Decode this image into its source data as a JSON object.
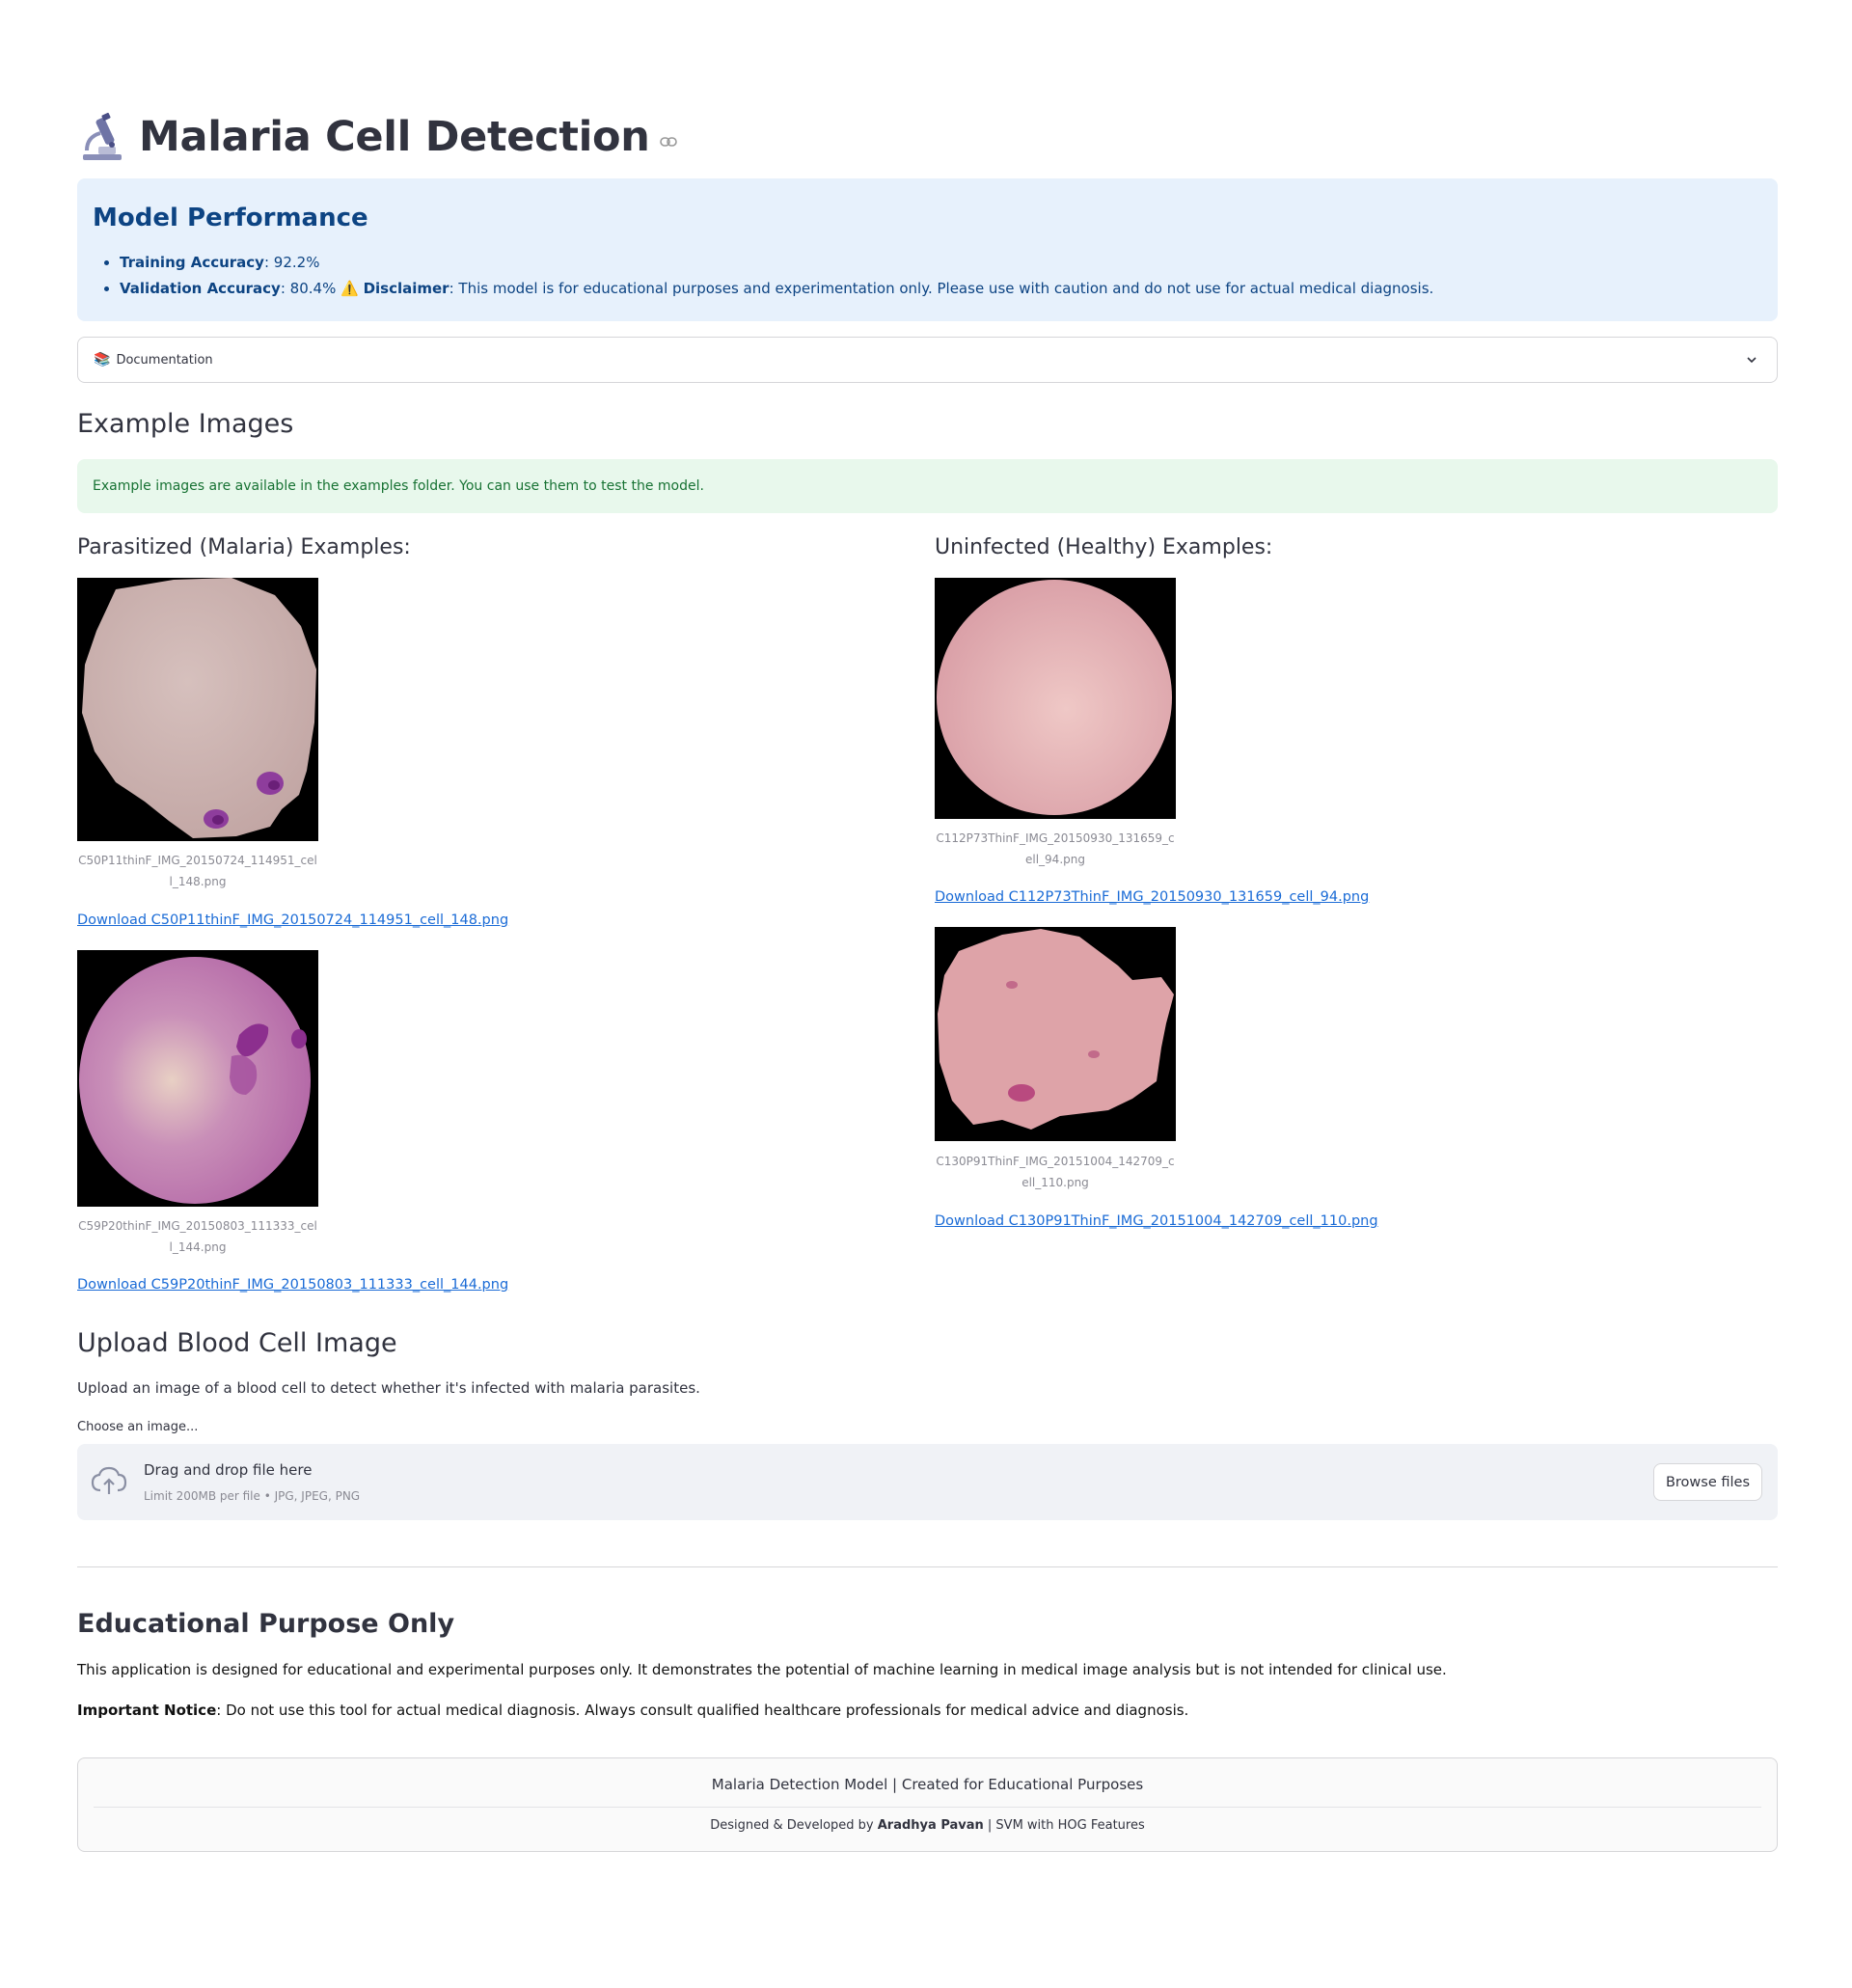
{
  "header": {
    "title": "Malaria Cell Detection",
    "icon": "microscope-icon"
  },
  "performance": {
    "title": "Model Performance",
    "training_label": "Training Accuracy",
    "training_value": ": 92.2%",
    "validation_label": "Validation Accuracy",
    "validation_value": ": 80.4% ",
    "warning_glyph": "⚠️",
    "disclaimer_label": "Disclaimer",
    "disclaimer_text": ": This model is for educational purposes and experimentation only. Please use with caution and do not use for actual medical diagnosis."
  },
  "documentation": {
    "icon_glyph": "📚",
    "label": "Documentation"
  },
  "examples": {
    "heading": "Example Images",
    "notice": "Example images are available in the examples folder. You can use them to test the model.",
    "parasitized": {
      "heading": "Parasitized (Malaria) Examples:",
      "items": [
        {
          "caption": "C50P11thinF_IMG_20150724_114951_cell_148.png",
          "download": "Download C50P11thinF_IMG_20150724_114951_cell_148.png"
        },
        {
          "caption": "C59P20thinF_IMG_20150803_111333_cell_144.png",
          "download": "Download C59P20thinF_IMG_20150803_111333_cell_144.png"
        }
      ]
    },
    "uninfected": {
      "heading": "Uninfected (Healthy) Examples:",
      "items": [
        {
          "caption": "C112P73ThinF_IMG_20150930_131659_cell_94.png",
          "download": "Download C112P73ThinF_IMG_20150930_131659_cell_94.png"
        },
        {
          "caption": "C130P91ThinF_IMG_20151004_142709_cell_110.png",
          "download": "Download C130P91ThinF_IMG_20151004_142709_cell_110.png"
        }
      ]
    }
  },
  "upload": {
    "heading": "Upload Blood Cell Image",
    "description": "Upload an image of a blood cell to detect whether it's infected with malaria parasites.",
    "field_label": "Choose an image...",
    "drop_text": "Drag and drop file here",
    "limit_text": "Limit 200MB per file • JPG, JPEG, PNG",
    "browse_label": "Browse files"
  },
  "education": {
    "heading": "Educational Purpose Only",
    "paragraph1": "This application is designed for educational and experimental purposes only. It demonstrates the potential of machine learning in medical image analysis but is not intended for clinical use.",
    "notice_label": "Important Notice",
    "notice_text": ": Do not use this tool for actual medical diagnosis. Always consult qualified healthcare professionals for medical advice and diagnosis."
  },
  "footer": {
    "line1": "Malaria Detection Model | Created for Educational Purposes",
    "line2_prefix": "Designed & Developed by ",
    "author": "Aradhya Pavan",
    "line2_suffix": " | SVM with HOG Features"
  },
  "colors": {
    "info_bg": "#e7f1fc",
    "info_text": "#0d4483",
    "success_bg": "#e8f8ec",
    "success_text": "#177233",
    "link": "#1a6bd6"
  }
}
